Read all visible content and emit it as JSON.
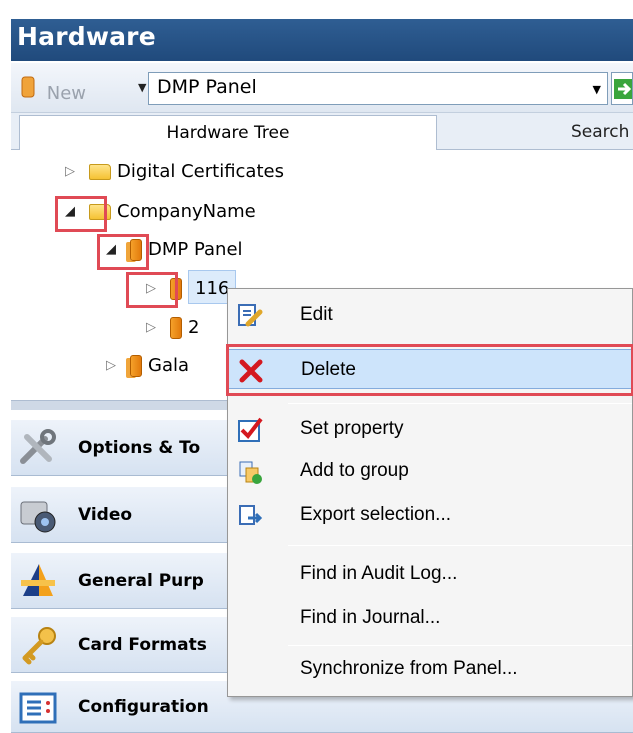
{
  "header": {
    "title": "Hardware"
  },
  "toolbar": {
    "new_label": "New",
    "combo_value": "DMP Panel"
  },
  "tabs": [
    {
      "label": "Hardware Tree"
    },
    {
      "label": "Search"
    }
  ],
  "tree": {
    "nodes": [
      {
        "label": "Digital Certificates"
      },
      {
        "label": "CompanyName"
      },
      {
        "label": "DMP Panel"
      },
      {
        "label": "116"
      },
      {
        "label": "2"
      },
      {
        "label": "Gala"
      }
    ]
  },
  "nav": {
    "items": [
      {
        "label": "Options & To"
      },
      {
        "label": "Video"
      },
      {
        "label": "General Purp"
      },
      {
        "label": "Card Formats"
      },
      {
        "label": "Configuration"
      }
    ]
  },
  "context_menu": {
    "items": [
      {
        "label": "Edit"
      },
      {
        "label": "Delete"
      },
      {
        "label": "Set property"
      },
      {
        "label": "Add to group"
      },
      {
        "label": "Export selection..."
      },
      {
        "label": "Find in Audit Log..."
      },
      {
        "label": "Find in Journal..."
      },
      {
        "label": "Synchronize from Panel..."
      }
    ]
  },
  "colors": {
    "header_bg": "#2a5689",
    "highlight": "#e04a55",
    "menu_hover": "#cde4fb"
  }
}
